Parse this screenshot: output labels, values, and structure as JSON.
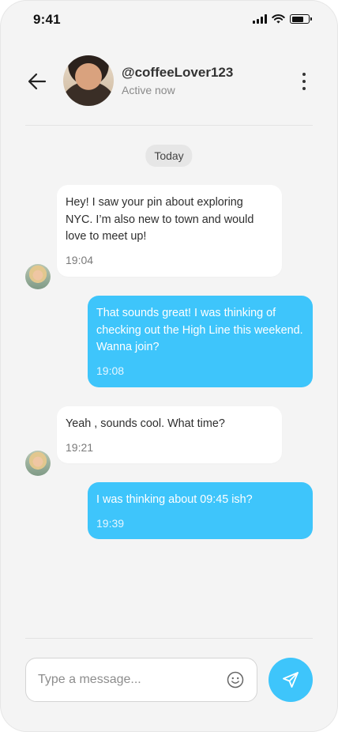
{
  "status_bar": {
    "time": "9:41"
  },
  "header": {
    "username": "@coffeeLover123",
    "status": "Active now"
  },
  "date_divider": "Today",
  "messages": [
    {
      "direction": "incoming",
      "text": "Hey! I saw your pin about exploring NYC. I’m also new to town and would love to meet up!",
      "time": "19:04"
    },
    {
      "direction": "outgoing",
      "text": "That sounds great! I was thinking of checking out the High Line this weekend. Wanna join?",
      "time": "19:08"
    },
    {
      "direction": "incoming",
      "text": "Yeah , sounds cool. What time?",
      "time": "19:21"
    },
    {
      "direction": "outgoing",
      "text": "I was thinking about 09:45 ish?",
      "time": "19:39"
    }
  ],
  "composer": {
    "placeholder": "Type a message..."
  },
  "icons": {
    "back": "arrow-left-icon",
    "more": "more-vertical-icon",
    "emoji": "smiley-icon",
    "send": "paper-plane-icon",
    "signal": "cellular-signal-icon",
    "wifi": "wifi-icon",
    "battery": "battery-icon"
  },
  "colors": {
    "accent": "#3EC5FB",
    "background": "#F4F4F4",
    "incoming_bubble": "#FFFFFF"
  }
}
